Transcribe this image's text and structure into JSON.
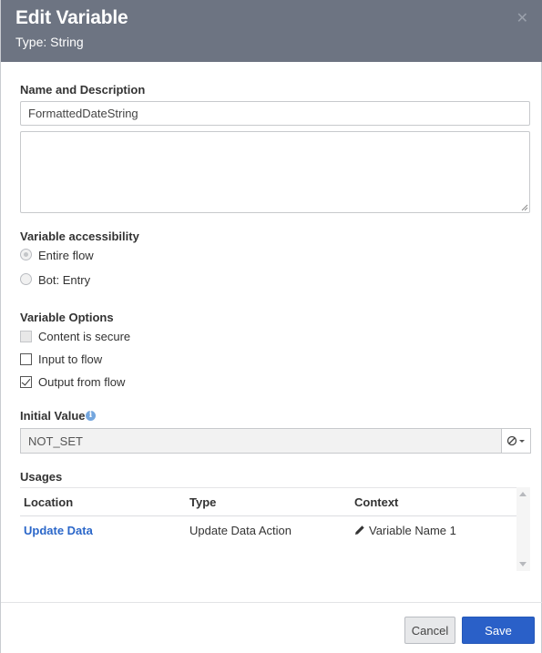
{
  "header": {
    "title": "Edit Variable",
    "subtitle": "Type: String",
    "close_icon": "close-icon"
  },
  "name_section": {
    "label": "Name and Description",
    "name_value": "FormattedDateString",
    "description_value": ""
  },
  "accessibility": {
    "label": "Variable accessibility",
    "options": [
      {
        "label": "Entire flow",
        "checked": true
      },
      {
        "label": "Bot: Entry",
        "checked": false
      }
    ]
  },
  "options": {
    "label": "Variable Options",
    "items": [
      {
        "label": "Content is secure",
        "checked": false,
        "disabled": true
      },
      {
        "label": "Input to flow",
        "checked": false
      },
      {
        "label": "Output from flow",
        "checked": true
      }
    ]
  },
  "initial_value": {
    "label": "Initial Value",
    "info_icon": "info-icon",
    "value": "NOT_SET",
    "button_icon": "no-value-icon"
  },
  "usages": {
    "label": "Usages",
    "columns": [
      "Location",
      "Type",
      "Context"
    ],
    "rows": [
      {
        "location": "Update Data",
        "type": "Update Data Action",
        "context": "Variable Name 1",
        "context_icon": "pencil-icon"
      }
    ]
  },
  "footer": {
    "cancel_label": "Cancel",
    "save_label": "Save"
  },
  "colors": {
    "header_bg": "#6d7482",
    "link": "#2b67c9",
    "primary_button": "#2a60c8",
    "info_icon": "#74a6de"
  }
}
